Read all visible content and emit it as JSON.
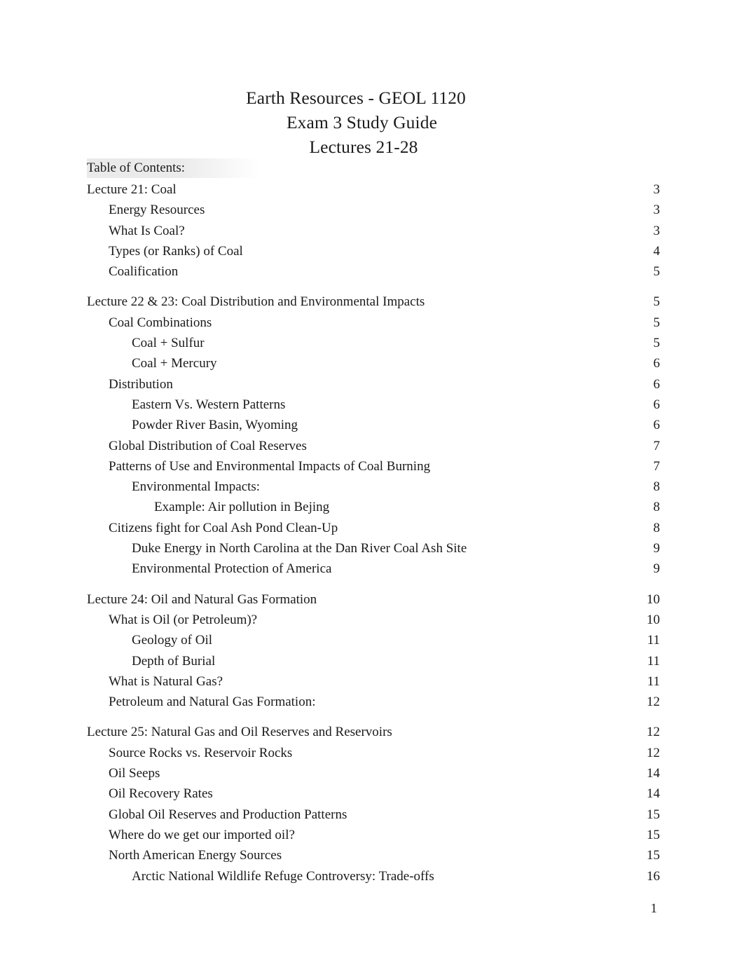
{
  "document": {
    "title_lines": [
      "Earth Resources - GEOL 1120",
      "Exam 3 Study Guide",
      "Lectures 21-28"
    ],
    "toc_heading": "Table of Contents:",
    "footer_page_number": "1",
    "shading_color": "#e9e9e9",
    "text_color": "#1c1c1c"
  },
  "toc": {
    "groups": [
      {
        "entries": [
          {
            "level": 1,
            "label": "Lecture 21: Coal",
            "page": "3"
          },
          {
            "level": 2,
            "label": "Energy Resources",
            "page": "3"
          },
          {
            "level": 2,
            "label": "What Is Coal?",
            "page": "3"
          },
          {
            "level": 2,
            "label": "Types (or Ranks) of Coal",
            "page": "4"
          },
          {
            "level": 2,
            "label": "Coalification",
            "page": "5"
          }
        ]
      },
      {
        "entries": [
          {
            "level": 1,
            "label": "Lecture 22 & 23: Coal Distribution and Environmental Impacts",
            "page": "5"
          },
          {
            "level": 2,
            "label": "Coal Combinations",
            "page": "5"
          },
          {
            "level": 3,
            "label": "Coal + Sulfur",
            "page": "5"
          },
          {
            "level": 3,
            "label": "Coal + Mercury",
            "page": "6"
          },
          {
            "level": 2,
            "label": "Distribution",
            "page": "6"
          },
          {
            "level": 3,
            "label": "Eastern Vs. Western Patterns",
            "page": "6"
          },
          {
            "level": 3,
            "label": "Powder River Basin, Wyoming",
            "page": "6"
          },
          {
            "level": 2,
            "label": "Global Distribution of Coal Reserves",
            "page": "7"
          },
          {
            "level": 2,
            "label": "Patterns of Use and Environmental Impacts of Coal Burning",
            "page": "7"
          },
          {
            "level": 3,
            "label": "Environmental Impacts:",
            "page": "8"
          },
          {
            "level": 4,
            "label": "Example: Air pollution in Bejing",
            "page": "8"
          },
          {
            "level": 2,
            "label": "Citizens fight for Coal Ash Pond Clean-Up",
            "page": "8"
          },
          {
            "level": 3,
            "label": "Duke Energy in North Carolina at the Dan River Coal Ash Site",
            "page": "9"
          },
          {
            "level": 3,
            "label": "Environmental Protection of America",
            "page": "9"
          }
        ]
      },
      {
        "entries": [
          {
            "level": 1,
            "label": "Lecture 24: Oil and Natural Gas Formation",
            "page": "10"
          },
          {
            "level": 2,
            "label": "What is Oil (or Petroleum)?",
            "page": "10"
          },
          {
            "level": 3,
            "label": "Geology of Oil",
            "page": "11"
          },
          {
            "level": 3,
            "label": "Depth of Burial",
            "page": "11"
          },
          {
            "level": 2,
            "label": "What is Natural Gas?",
            "page": "11"
          },
          {
            "level": 2,
            "label": "Petroleum and Natural Gas Formation:",
            "page": "12"
          }
        ]
      },
      {
        "entries": [
          {
            "level": 1,
            "label": "Lecture 25: Natural Gas and Oil Reserves and Reservoirs",
            "page": "12"
          },
          {
            "level": 2,
            "label": "Source Rocks vs. Reservoir Rocks",
            "page": "12"
          },
          {
            "level": 2,
            "label": "Oil Seeps",
            "page": "14"
          },
          {
            "level": 2,
            "label": "Oil Recovery Rates",
            "page": "14"
          },
          {
            "level": 2,
            "label": "Global Oil Reserves and Production Patterns",
            "page": "15"
          },
          {
            "level": 2,
            "label": "Where do we get our imported oil?",
            "page": "15"
          },
          {
            "level": 2,
            "label": "North American Energy Sources",
            "page": "15"
          },
          {
            "level": 3,
            "label": "Arctic National Wildlife Refuge Controversy: Trade-offs",
            "page": "16"
          }
        ]
      }
    ]
  }
}
